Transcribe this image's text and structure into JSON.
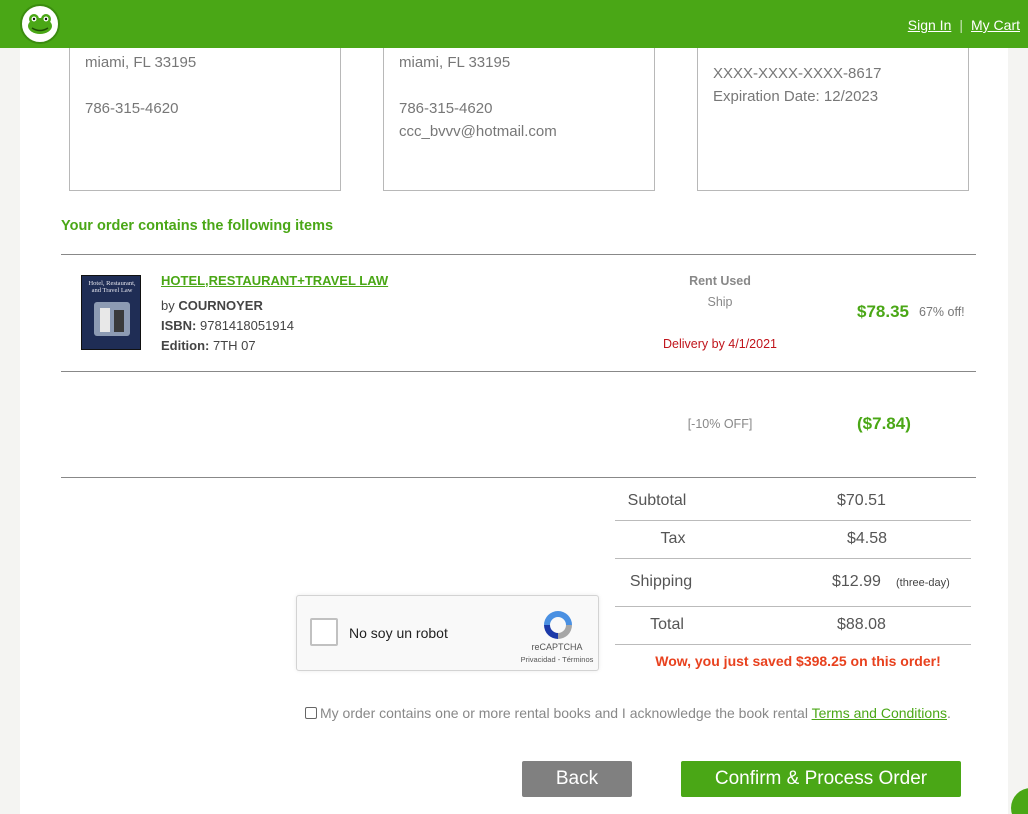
{
  "header": {
    "sign_in": "Sign In",
    "separator": "|",
    "my_cart": "My Cart"
  },
  "billing_address": {
    "city_line": "miami, FL  33195",
    "phone": "786-315-4620"
  },
  "shipping_address": {
    "city_line": "miami, FL  33195",
    "phone": "786-315-4620",
    "email": "ccc_bvvv@hotmail.com"
  },
  "payment": {
    "card": "XXXX-XXXX-XXXX-8617",
    "expiration": "Expiration Date: 12/2023"
  },
  "order_heading": "Your order contains the following items",
  "item": {
    "cover_text": "Hotel, Restaurant, and Travel Law",
    "title": "HOTEL,RESTAURANT+TRAVEL LAW",
    "by_prefix": "by ",
    "author": "COURNOYER",
    "isbn_label": "ISBN:",
    "isbn": " 9781418051914",
    "edition_label": "Edition:",
    "edition": " 7TH 07",
    "type": "Rent Used",
    "shipping": "Ship",
    "delivery": "Delivery by 4/1/2021",
    "price": "$78.35",
    "off": "67% off!"
  },
  "discount": {
    "label": "[-10% OFF]",
    "value": "($7.84)"
  },
  "totals": {
    "subtotal_label": "Subtotal",
    "subtotal": "$70.51",
    "tax_label": "Tax",
    "tax": "$4.58",
    "shipping_label": "Shipping",
    "shipping": "$12.99",
    "shipping_note": "(three-day)",
    "total_label": "Total",
    "total": "$88.08"
  },
  "savings": "Wow, you just saved $398.25 on this order!",
  "recaptcha": {
    "label": "No soy un robot",
    "brand": "reCAPTCHA",
    "links": "Privacidad - Términos"
  },
  "acknowledgement": {
    "text": "My order contains one or more rental books and I acknowledge the book rental ",
    "link": "Terms and Conditions",
    "end": "."
  },
  "buttons": {
    "back": "Back",
    "confirm": "Confirm & Process Order"
  },
  "colors": {
    "brand_green": "#4aa716",
    "delivery_red": "#c0141b",
    "savings_orange": "#e8411e",
    "back_gray": "#808080"
  }
}
